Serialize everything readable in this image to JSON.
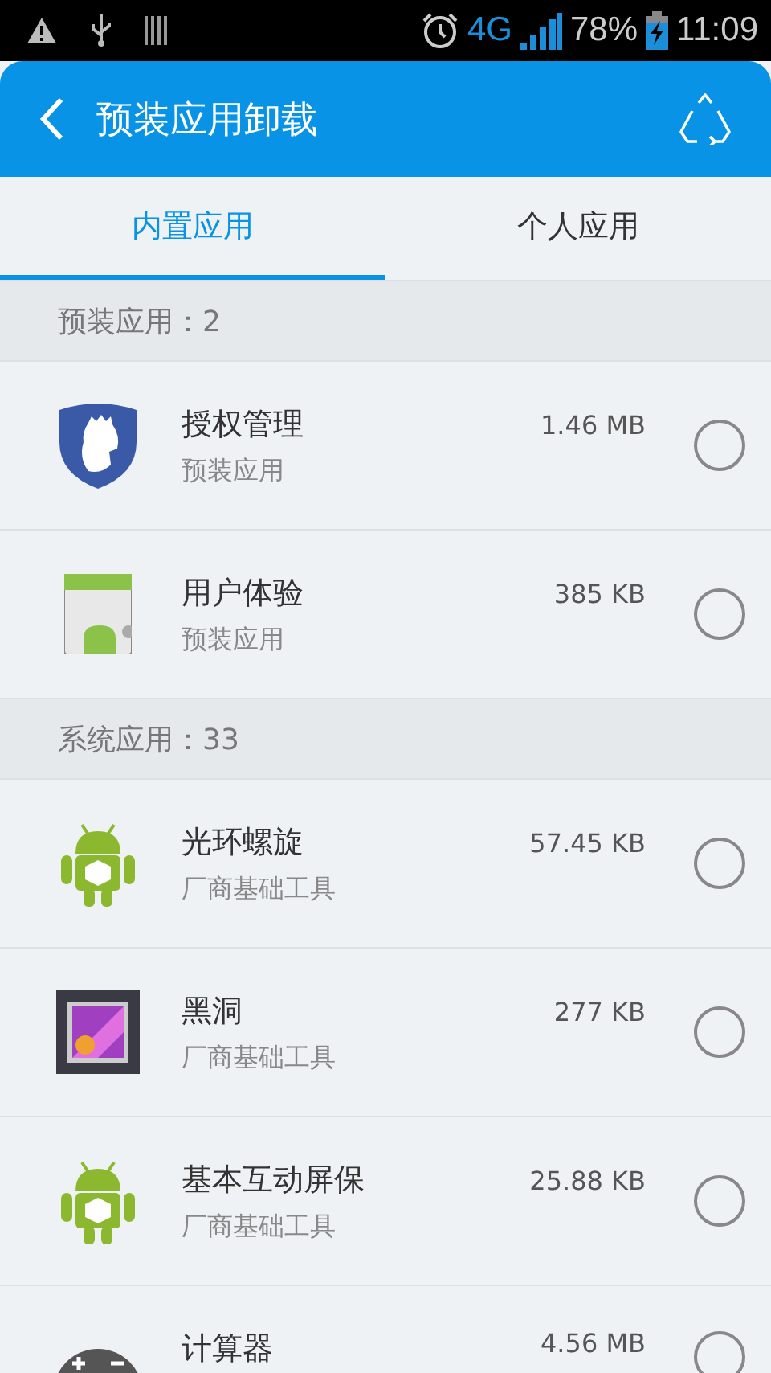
{
  "status_bar": {
    "signal_label": "4G",
    "battery": "78%",
    "time": "11:09"
  },
  "header": {
    "title": "预装应用卸载"
  },
  "tabs": [
    {
      "label": "内置应用",
      "selected": true
    },
    {
      "label": "个人应用",
      "selected": false
    }
  ],
  "sections": [
    {
      "title": "预装应用：2",
      "apps": [
        {
          "kind": "shield",
          "name": "授权管理",
          "subtitle": "预装应用",
          "size": "1.46 MB",
          "selected": false
        },
        {
          "kind": "android-doc",
          "name": "用户体验",
          "subtitle": "预装应用",
          "size": "385 KB",
          "selected": false
        }
      ]
    },
    {
      "title": "系统应用：33",
      "apps": [
        {
          "kind": "android",
          "name": "光环螺旋",
          "subtitle": "厂商基础工具",
          "size": "57.45 KB",
          "selected": false
        },
        {
          "kind": "gallery",
          "name": "黑洞",
          "subtitle": "厂商基础工具",
          "size": "277 KB",
          "selected": false
        },
        {
          "kind": "android",
          "name": "基本互动屏保",
          "subtitle": "厂商基础工具",
          "size": "25.88 KB",
          "selected": false
        },
        {
          "kind": "calculator",
          "name": "计算器",
          "size": "4.56 MB",
          "selected": false
        }
      ]
    }
  ]
}
